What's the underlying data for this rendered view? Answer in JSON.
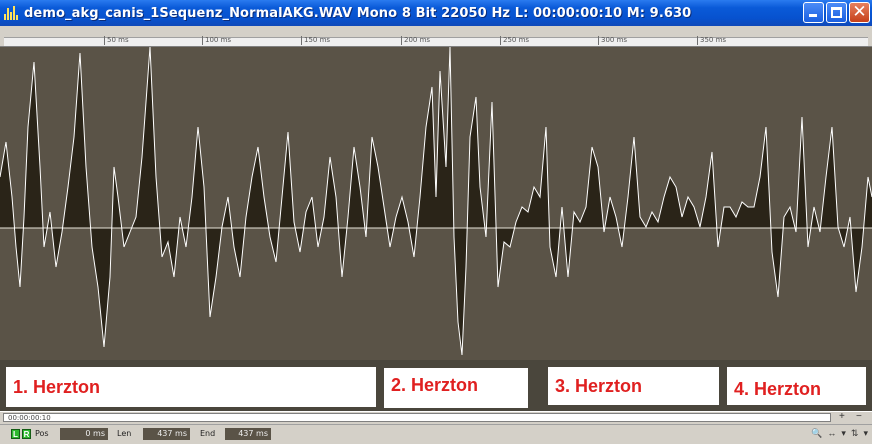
{
  "window": {
    "title": "demo_akg_canis_1Sequenz_NormalAKG.WAV  Mono 8 Bit 22050 Hz L: 00:00:00:10 M: 9.630",
    "colors": {
      "titlebar": "#0752cf",
      "waveform_bg": "#5a5347",
      "waveform_fill": "#2a2418",
      "waveform_line": "#ffffff",
      "label_text": "#e02020"
    },
    "buttons": {
      "minimize_icon": "minimize-icon",
      "maximize_icon": "maximize-icon",
      "close_icon": "close-icon"
    }
  },
  "ruler": {
    "ticks": [
      "50 ms",
      "100 ms",
      "150 ms",
      "200 ms",
      "250 ms",
      "300 ms",
      "350 ms"
    ]
  },
  "labels": [
    "1. Herzton",
    "2. Herzton",
    "3. Herzton",
    "4. Herzton"
  ],
  "scrollbar": {
    "time": "00:00:00:10",
    "plus": "+",
    "minus": "−"
  },
  "status": {
    "left_channel": "L",
    "right_channel": "R",
    "pos_label": "Pos",
    "pos_value": "0 ms",
    "len_label": "Len",
    "len_value": "437 ms",
    "end_label": "End",
    "end_value": "437 ms",
    "nav_icons": [
      "zoom-icon",
      "horizontal-arrows-icon",
      "dropdown-icon",
      "vertical-arrows-icon",
      "dropdown-icon"
    ]
  }
}
